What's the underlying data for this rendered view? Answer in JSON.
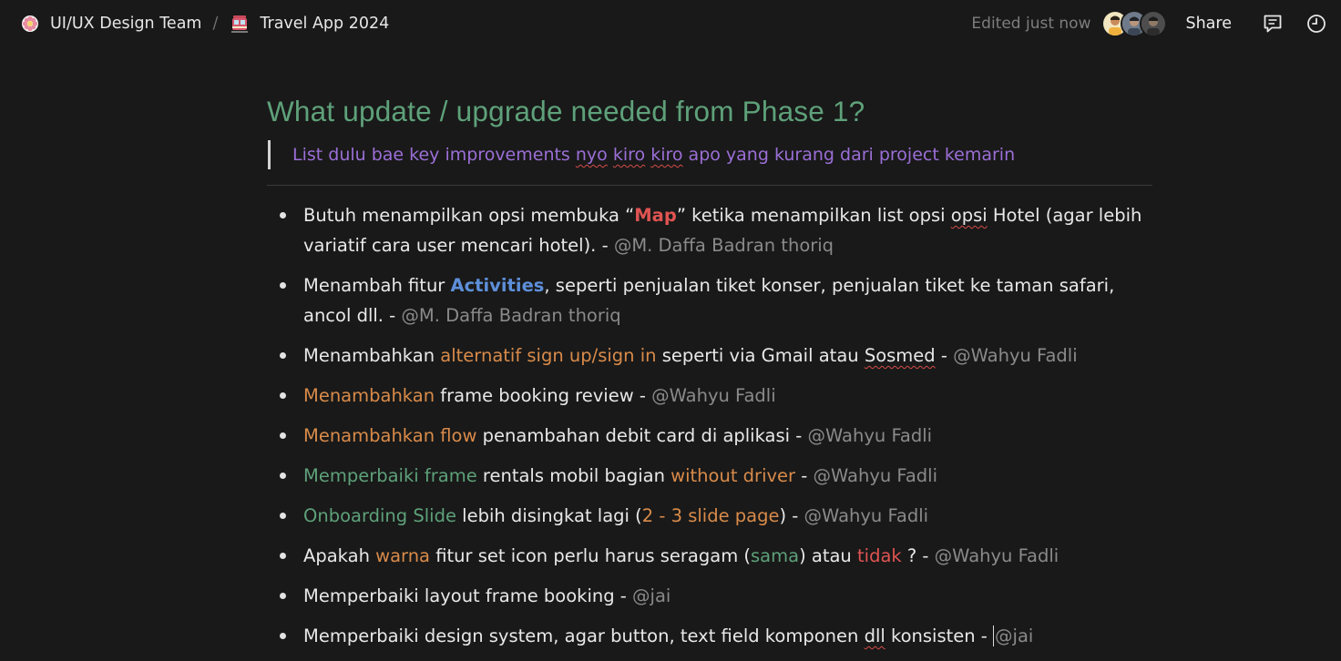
{
  "breadcrumb": {
    "workspace": "UI/UX Design Team",
    "separator": "/",
    "page": "Travel App 2024"
  },
  "header": {
    "edited": "Edited just now",
    "share": "Share",
    "icons": [
      "comments-icon",
      "history-clock-icon"
    ]
  },
  "doc": {
    "heading": "What update / upgrade needed from Phase 1?",
    "quote": {
      "p1": "List dulu bae key improvements ",
      "w1": "nyo",
      "s1": " ",
      "w2": "kiro",
      "s2": " ",
      "w3": "kiro",
      "p2": " apo yang kurang dari project kemarin"
    },
    "items": [
      {
        "t1": "Butuh menampilkan opsi membuka “",
        "h1": "Map",
        "t2": "” ketika menampilkan list opsi ",
        "u1": "opsi",
        "t3": " Hotel (agar lebih variatif cara user mencari hotel). - ",
        "mention": "@M. Daffa Badran thoriq"
      },
      {
        "t1": "Menambah fitur ",
        "h1": "Activities",
        "t2": ", seperti penjualan tiket konser, penjualan tiket ke taman safari, ancol dll. - ",
        "mention": "@M. Daffa Badran thoriq"
      },
      {
        "t1": "Menambahkan ",
        "h1": "alternatif sign up/sign in",
        "t2": " seperti via Gmail atau ",
        "u1": "Sosmed",
        "t3": " - ",
        "mention": "@Wahyu Fadli"
      },
      {
        "h1": "Menambahkan",
        "t1": " frame booking review - ",
        "mention": "@Wahyu Fadli"
      },
      {
        "h1": "Menambahkan flow",
        "t1": " penambahan debit card di aplikasi - ",
        "mention": "@Wahyu Fadli"
      },
      {
        "h1": "Memperbaiki frame",
        "t1": " rentals mobil bagian ",
        "h2": "without driver",
        "t2": " - ",
        "mention": "@Wahyu Fadli"
      },
      {
        "h1": "Onboarding Slide",
        "t1": " lebih disingkat lagi (",
        "h2": "2 - 3 slide page",
        "t2": ") - ",
        "mention": "@Wahyu Fadli"
      },
      {
        "t1": "Apakah ",
        "h1": "warna",
        "t2": " fitur set icon perlu harus seragam (",
        "h2": "sama",
        "t3": ") atau ",
        "h3": "tidak",
        "t4": " ? - ",
        "mention": "@Wahyu Fadli"
      },
      {
        "t1": "Memperbaiki layout frame booking - ",
        "mention": "@jai"
      },
      {
        "t1": "Memperbaiki design system, agar button, text field komponen ",
        "u1": "dll",
        "t2": " konsisten - ",
        "mention": "@jai"
      }
    ]
  },
  "colors": {
    "background": "#191919",
    "heading": "#5ea17a",
    "quote": "#9b6fd6",
    "red": "#df5452",
    "blue": "#5d8fd9",
    "orange": "#d98b4a",
    "mention": "#8a8a8a"
  }
}
